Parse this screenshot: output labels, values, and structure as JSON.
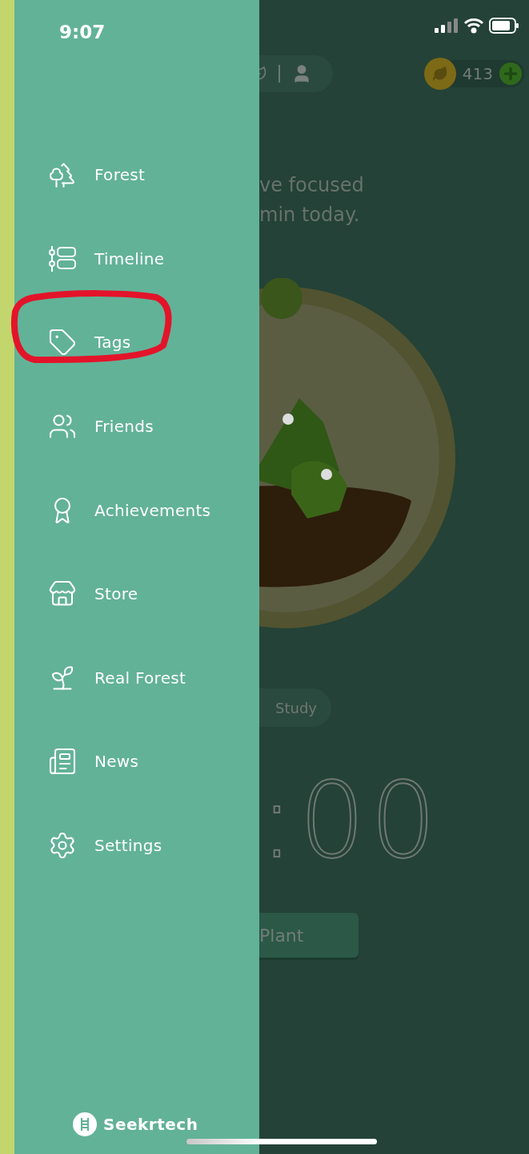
{
  "status_bar": {
    "time": "9:07"
  },
  "menu": [
    {
      "label": "Forest",
      "kind": "forest",
      "circled": false
    },
    {
      "label": "Timeline",
      "kind": "timeline",
      "circled": false
    },
    {
      "label": "Tags",
      "kind": "tags",
      "circled": true
    },
    {
      "label": "Friends",
      "kind": "friends",
      "circled": false
    },
    {
      "label": "Achievements",
      "kind": "achievements",
      "circled": false
    },
    {
      "label": "Store",
      "kind": "store",
      "circled": false
    },
    {
      "label": "Real Forest",
      "kind": "realforest",
      "circled": false
    },
    {
      "label": "News",
      "kind": "news",
      "circled": false
    },
    {
      "label": "Settings",
      "kind": "settings",
      "circled": false
    }
  ],
  "brand": "Seekrtech",
  "background": {
    "focus_text": [
      "ve focused",
      "min today."
    ],
    "coins": "413",
    "tag": "Study",
    "timer": ":00",
    "plant_button": "Plant"
  }
}
